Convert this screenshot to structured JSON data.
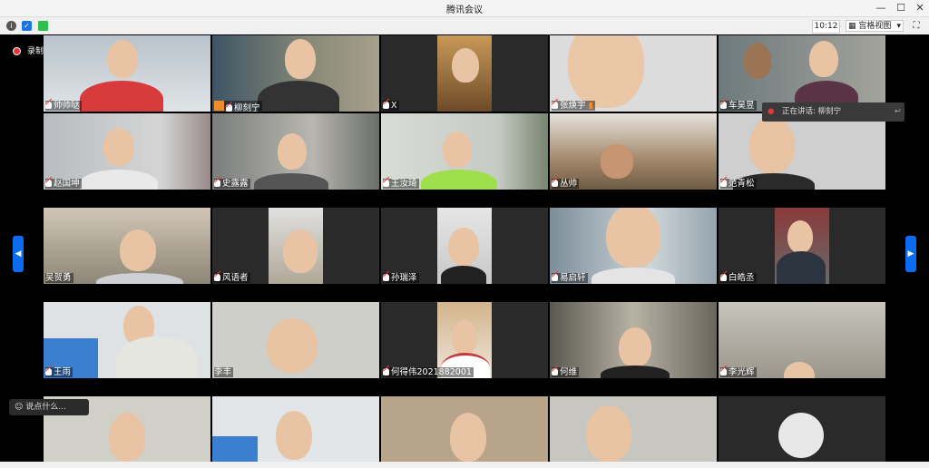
{
  "window": {
    "title": "腾讯会议",
    "minimize": "—",
    "maximize": "☐",
    "close": "✕"
  },
  "toolbar": {
    "time": "10:12",
    "view_label": "宫格视图",
    "view_chevron": "▾",
    "fullscreen": "⛶",
    "info": "i",
    "shield": "✓"
  },
  "recording": {
    "label": "录制中"
  },
  "speaking": {
    "label": "正在讲话: 柳刻宁"
  },
  "chat": {
    "placeholder": "说点什么..."
  },
  "nav": {
    "prev": "◀",
    "next": "▶"
  },
  "participants": [
    {
      "name": "帅帅哒"
    },
    {
      "name": "柳刻宁"
    },
    {
      "name": "X"
    },
    {
      "name": "张焕宇"
    },
    {
      "name": "车昊昱"
    },
    {
      "name": "赵国坤"
    },
    {
      "name": "史露露"
    },
    {
      "name": "王汝琦"
    },
    {
      "name": "丛帅"
    },
    {
      "name": "范青松"
    },
    {
      "name": "吴贺勇"
    },
    {
      "name": "风语者"
    },
    {
      "name": "孙瑞泽"
    },
    {
      "name": "易启轩"
    },
    {
      "name": "白皓丞"
    },
    {
      "name": "王雨"
    },
    {
      "name": "李丰"
    },
    {
      "name": "何得伟2021882001"
    },
    {
      "name": "何维"
    },
    {
      "name": "李光辉"
    }
  ]
}
